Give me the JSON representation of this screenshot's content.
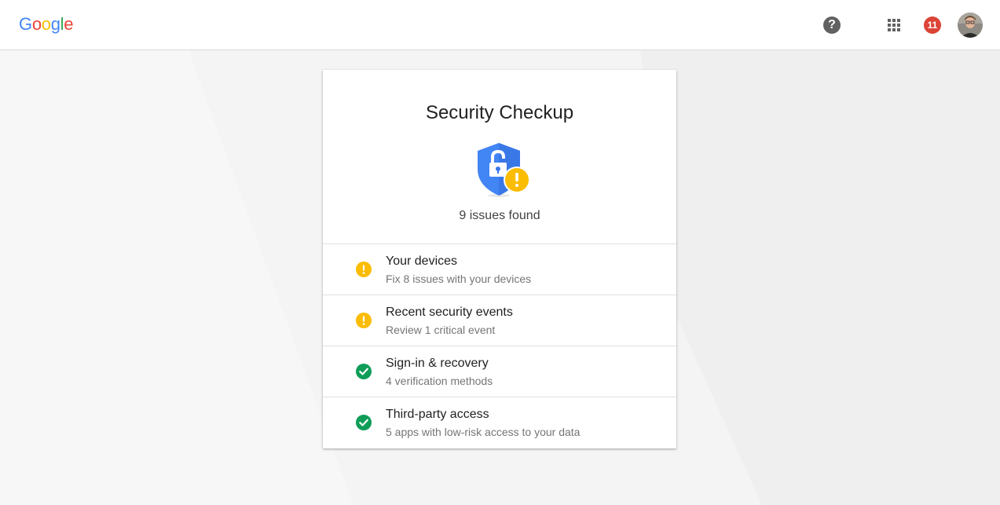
{
  "header": {
    "logo_letters": [
      {
        "char": "G",
        "color": "#4285F4"
      },
      {
        "char": "o",
        "color": "#EA4335"
      },
      {
        "char": "o",
        "color": "#FBBC05"
      },
      {
        "char": "g",
        "color": "#4285F4"
      },
      {
        "char": "l",
        "color": "#34A853"
      },
      {
        "char": "e",
        "color": "#EA4335"
      }
    ],
    "help_label": "?",
    "notification_count": "11"
  },
  "card": {
    "title": "Security Checkup",
    "issues_summary": "9 issues found",
    "items": [
      {
        "title": "Your devices",
        "subtitle": "Fix 8 issues with your devices",
        "status": "warning"
      },
      {
        "title": "Recent security events",
        "subtitle": "Review 1 critical event",
        "status": "warning"
      },
      {
        "title": "Sign-in & recovery",
        "subtitle": "4 verification methods",
        "status": "ok"
      },
      {
        "title": "Third-party access",
        "subtitle": "5 apps with low-risk access to your data",
        "status": "ok"
      }
    ]
  },
  "icons": {
    "help": "help-circle-icon",
    "apps": "apps-grid-icon",
    "notifications": "notifications-badge",
    "shield": "shield-unlocked-warning-icon",
    "warning": "warning-circle-icon",
    "ok": "check-circle-icon"
  },
  "colors": {
    "warning": "#FBBC04",
    "ok": "#0F9D58",
    "shield": "#4285F4",
    "notification": "#DB4437"
  }
}
